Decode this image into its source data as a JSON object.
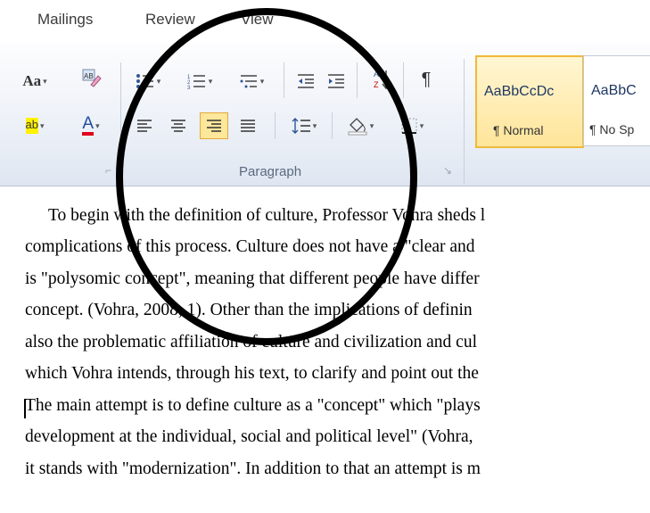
{
  "tabs": [
    "Mailings",
    "Review",
    "View"
  ],
  "ribbon": {
    "change_case": "Aa",
    "highlight": "ab",
    "font_color": "A",
    "pilcrow": "¶",
    "paragraph_label": "Paragraph",
    "styles": [
      {
        "sample": "AaBbCcDc",
        "name": "¶ Normal"
      },
      {
        "sample": "AaBbC",
        "name": "¶ No Sp"
      }
    ]
  },
  "document": {
    "lines": [
      "To begin with the definition of culture, Professor Vohra sheds l",
      "complications of this process. Culture does not have a \"clear and",
      "is \"polysomic concept\", meaning that different people have differ",
      "concept. (Vohra, 2008, 1). Other than the implications of definin",
      "also the problematic affiliation of culture and civilization and cul",
      "which Vohra intends, through his text, to clarify and point out the",
      "The main attempt is to define culture as a \"concept\" which \"plays",
      "development at the individual, social and political level\" (Vohra,",
      "it stands with \"modernization\". In addition to that an attempt is m"
    ]
  },
  "colors": {
    "accent_underline": "#e0001a",
    "selected_button": "#fde79a"
  }
}
